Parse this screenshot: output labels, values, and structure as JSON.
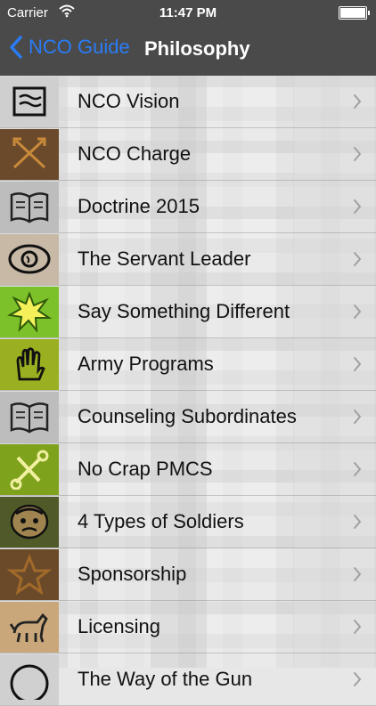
{
  "status_bar": {
    "carrier": "Carrier",
    "time": "11:47 PM"
  },
  "nav": {
    "back_label": "NCO Guide",
    "title": "Philosophy"
  },
  "colors": {
    "nav_bg": "#4a4a4a",
    "back_blue": "#2a7cf6"
  },
  "items": [
    {
      "label": "NCO Vision",
      "icon": "scroll-icon",
      "thumb_bg": "#cfcfcf"
    },
    {
      "label": "NCO Charge",
      "icon": "crossed-arrows-icon",
      "thumb_bg": "#6a4a2a"
    },
    {
      "label": "Doctrine 2015",
      "icon": "open-book-icon",
      "thumb_bg": "#bdbdbd"
    },
    {
      "label": "The Servant Leader",
      "icon": "eye-icon",
      "thumb_bg": "#c7b9a6"
    },
    {
      "label": "Say Something Different",
      "icon": "burst-icon",
      "thumb_bg": "#7cc02a"
    },
    {
      "label": "Army Programs",
      "icon": "hand-icon",
      "thumb_bg": "#9bb020"
    },
    {
      "label": "Counseling Subordinates",
      "icon": "open-book-icon",
      "thumb_bg": "#bdbdbd"
    },
    {
      "label": "No Crap PMCS",
      "icon": "tools-icon",
      "thumb_bg": "#7ea21c"
    },
    {
      "label": "4 Types of Soldiers",
      "icon": "face-icon",
      "thumb_bg": "#4f5a28"
    },
    {
      "label": "Sponsorship",
      "icon": "star-icon",
      "thumb_bg": "#6b4a2a"
    },
    {
      "label": "Licensing",
      "icon": "horse-icon",
      "thumb_bg": "#c9a77a"
    },
    {
      "label": "The Way of the Gun",
      "icon": "circle-icon",
      "thumb_bg": "#d0d0d0"
    }
  ]
}
